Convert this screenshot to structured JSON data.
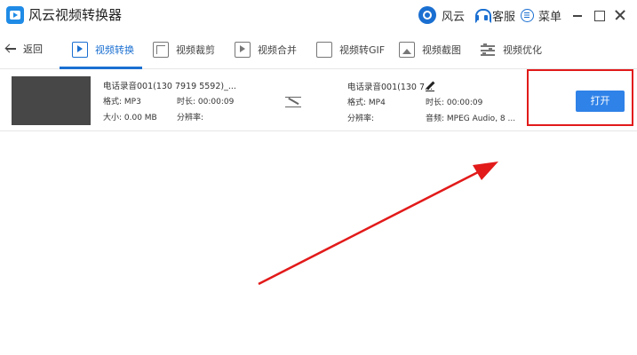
{
  "app": {
    "title": "风云视频转换器"
  },
  "titlebar": {
    "fengyun_label": "风云",
    "service_label": "客服",
    "menu_label": "菜单"
  },
  "nav": {
    "back_label": "返回",
    "tabs": [
      {
        "label": "视频转换",
        "active": true
      },
      {
        "label": "视频裁剪"
      },
      {
        "label": "视频合并"
      },
      {
        "label": "视频转GIF"
      },
      {
        "label": "视频截图"
      },
      {
        "label": "视频优化"
      }
    ]
  },
  "file": {
    "source": {
      "name": "电话录音001(130 7919 5592)_...",
      "format": "格式: MP3",
      "duration": "时长: 00:00:09",
      "size": "大小: 0.00 MB",
      "resolution": "分辨率:"
    },
    "output": {
      "name": "电话录音001(130 7...",
      "format": "格式: MP4",
      "duration": "时长: 00:00:09",
      "resolution": "分辨率:",
      "audio": "音频: MPEG Audio, 8 ..."
    },
    "open_button": "打开"
  },
  "colors": {
    "accent": "#1a6fd1",
    "button": "#2f82e8",
    "highlight": "#e21a1a",
    "arrow": "#e21a1a"
  }
}
